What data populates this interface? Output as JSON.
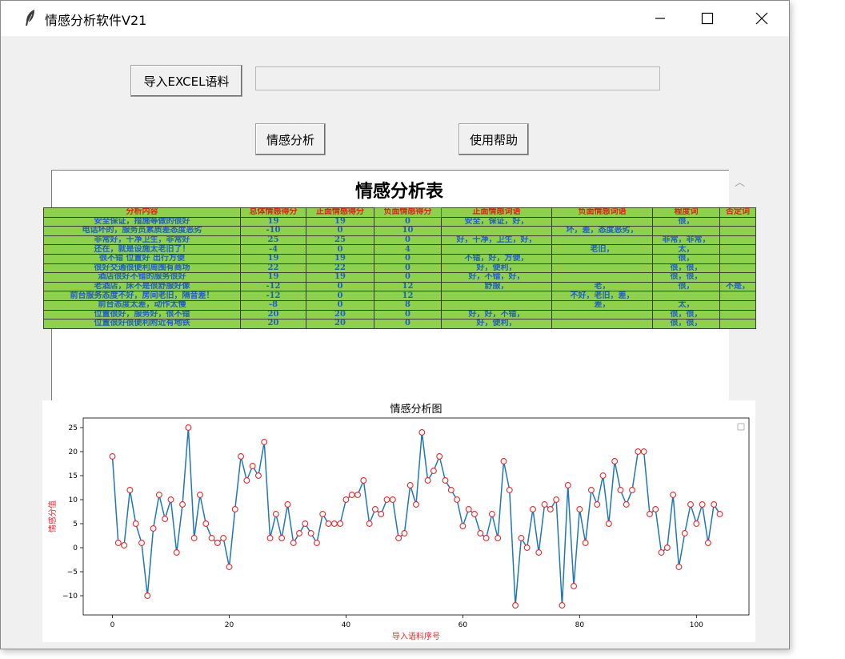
{
  "window": {
    "title": "情感分析软件V21"
  },
  "toolbar": {
    "import_label": "导入EXCEL语料",
    "path_value": "",
    "analyze_label": "情感分析",
    "help_label": "使用帮助"
  },
  "table": {
    "title": "情感分析表",
    "headers": [
      "分析内容",
      "总体情感得分",
      "正面情感得分",
      "负面情感得分",
      "正面情感词语",
      "负面情感词语",
      "程度词",
      "否定词"
    ],
    "rows": [
      [
        "安全保证，措施等做的很好",
        "19",
        "19",
        "0",
        "安全，保证，好，",
        "",
        "很，",
        ""
      ],
      [
        "电话坏的，服务员素质差态度恶劣",
        "-10",
        "0",
        "10",
        "",
        "坏，差，态度恶劣，",
        "",
        ""
      ],
      [
        "非常好，干净卫生，非常好",
        "25",
        "25",
        "0",
        "好，干净，卫生，好，",
        "",
        "非常，非常，",
        ""
      ],
      [
        "还在，就是设施太老旧了！",
        "-4",
        "0",
        "4",
        "",
        "老旧，",
        "太，",
        ""
      ],
      [
        "很不错 位置好 出行方便",
        "19",
        "19",
        "0",
        "不错，好，方便，",
        "",
        "很，",
        ""
      ],
      [
        "很好交通很便利周围有商场",
        "22",
        "22",
        "0",
        "好，便利，",
        "",
        "很，很，",
        ""
      ],
      [
        "酒店很好不错的服务很好",
        "19",
        "19",
        "0",
        "好，不错，好，",
        "",
        "很，很，",
        ""
      ],
      [
        "老酒店，床不是很舒服好像",
        "-12",
        "0",
        "12",
        "舒服，",
        "老，",
        "很，",
        "不是，"
      ],
      [
        "前台服务态度不好，房间老旧，隔音差！",
        "-12",
        "0",
        "12",
        "",
        "不好，老旧，差，",
        "",
        ""
      ],
      [
        "前台态度太差，动作太慢",
        "-8",
        "0",
        "8",
        "",
        "差，",
        "太，",
        ""
      ],
      [
        "位置很好，服务好，很不错",
        "20",
        "20",
        "0",
        "好，好，不错，",
        "",
        "很，很，",
        ""
      ],
      [
        "位置很好很便利附近有地铁",
        "20",
        "20",
        "0",
        "好，便利，",
        "",
        "很，很，",
        ""
      ]
    ]
  },
  "chart_data": {
    "type": "line",
    "title": "情感分析图",
    "xlabel": "导入语料序号",
    "ylabel": "情感分值",
    "xlim": [
      -5,
      109
    ],
    "ylim": [
      -14,
      27
    ],
    "xticks": [
      0,
      20,
      40,
      60,
      80,
      100
    ],
    "yticks": [
      -10,
      -5,
      0,
      5,
      10,
      15,
      20,
      25
    ],
    "grid": false,
    "legend": "top-right",
    "line_color": "#1f77b4",
    "marker_edge_color": "#e8272a",
    "series": [
      {
        "values": [
          19,
          1,
          0.5,
          12,
          5,
          1,
          -10,
          4,
          11,
          6,
          10,
          -1,
          9,
          25,
          2,
          11,
          5,
          2,
          1,
          2,
          -4,
          8,
          19,
          14,
          17,
          15,
          22,
          2,
          7,
          2,
          9,
          1,
          3,
          5,
          3,
          1,
          7,
          5,
          5,
          5,
          10,
          11,
          11,
          14,
          5,
          8,
          7,
          10,
          10,
          2,
          3,
          13,
          9,
          24,
          14,
          16,
          19,
          14,
          12,
          10,
          4.5,
          8,
          7,
          3,
          2,
          7,
          2,
          18,
          12,
          -12,
          2,
          0,
          8,
          -1,
          9,
          8,
          10,
          -12,
          13,
          -8,
          8,
          1,
          12,
          9,
          15,
          5,
          18,
          12,
          9,
          12,
          20,
          20,
          7,
          8,
          -1,
          0,
          11,
          -4,
          3,
          9,
          5,
          9,
          1,
          9,
          7
        ]
      }
    ]
  }
}
